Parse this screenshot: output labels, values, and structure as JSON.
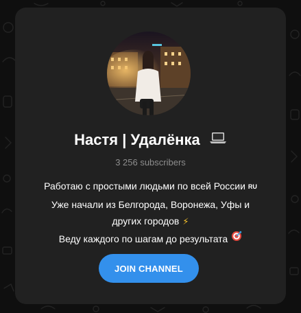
{
  "channel": {
    "name": "Настя | Удалёнка",
    "title_emoji_icon": "laptop-icon",
    "subscribers": "3 256 subscribers",
    "description_lines": [
      "Работаю с простыми людьми по всей России",
      "Уже начали из Белгорода, Воронежа, Уфы и",
      "других городов",
      "Веду каждого по шагам до результата"
    ],
    "flag_text": "RU",
    "line3_emoji": "⚡",
    "line4_emoji_icon": "target-icon"
  },
  "actions": {
    "join_label": "JOIN CHANNEL"
  },
  "colors": {
    "page_background": "#0f0f0f",
    "card_background": "#212121",
    "accent": "#3390ec",
    "text_primary": "#ffffff",
    "text_secondary": "#8e8e8e"
  }
}
